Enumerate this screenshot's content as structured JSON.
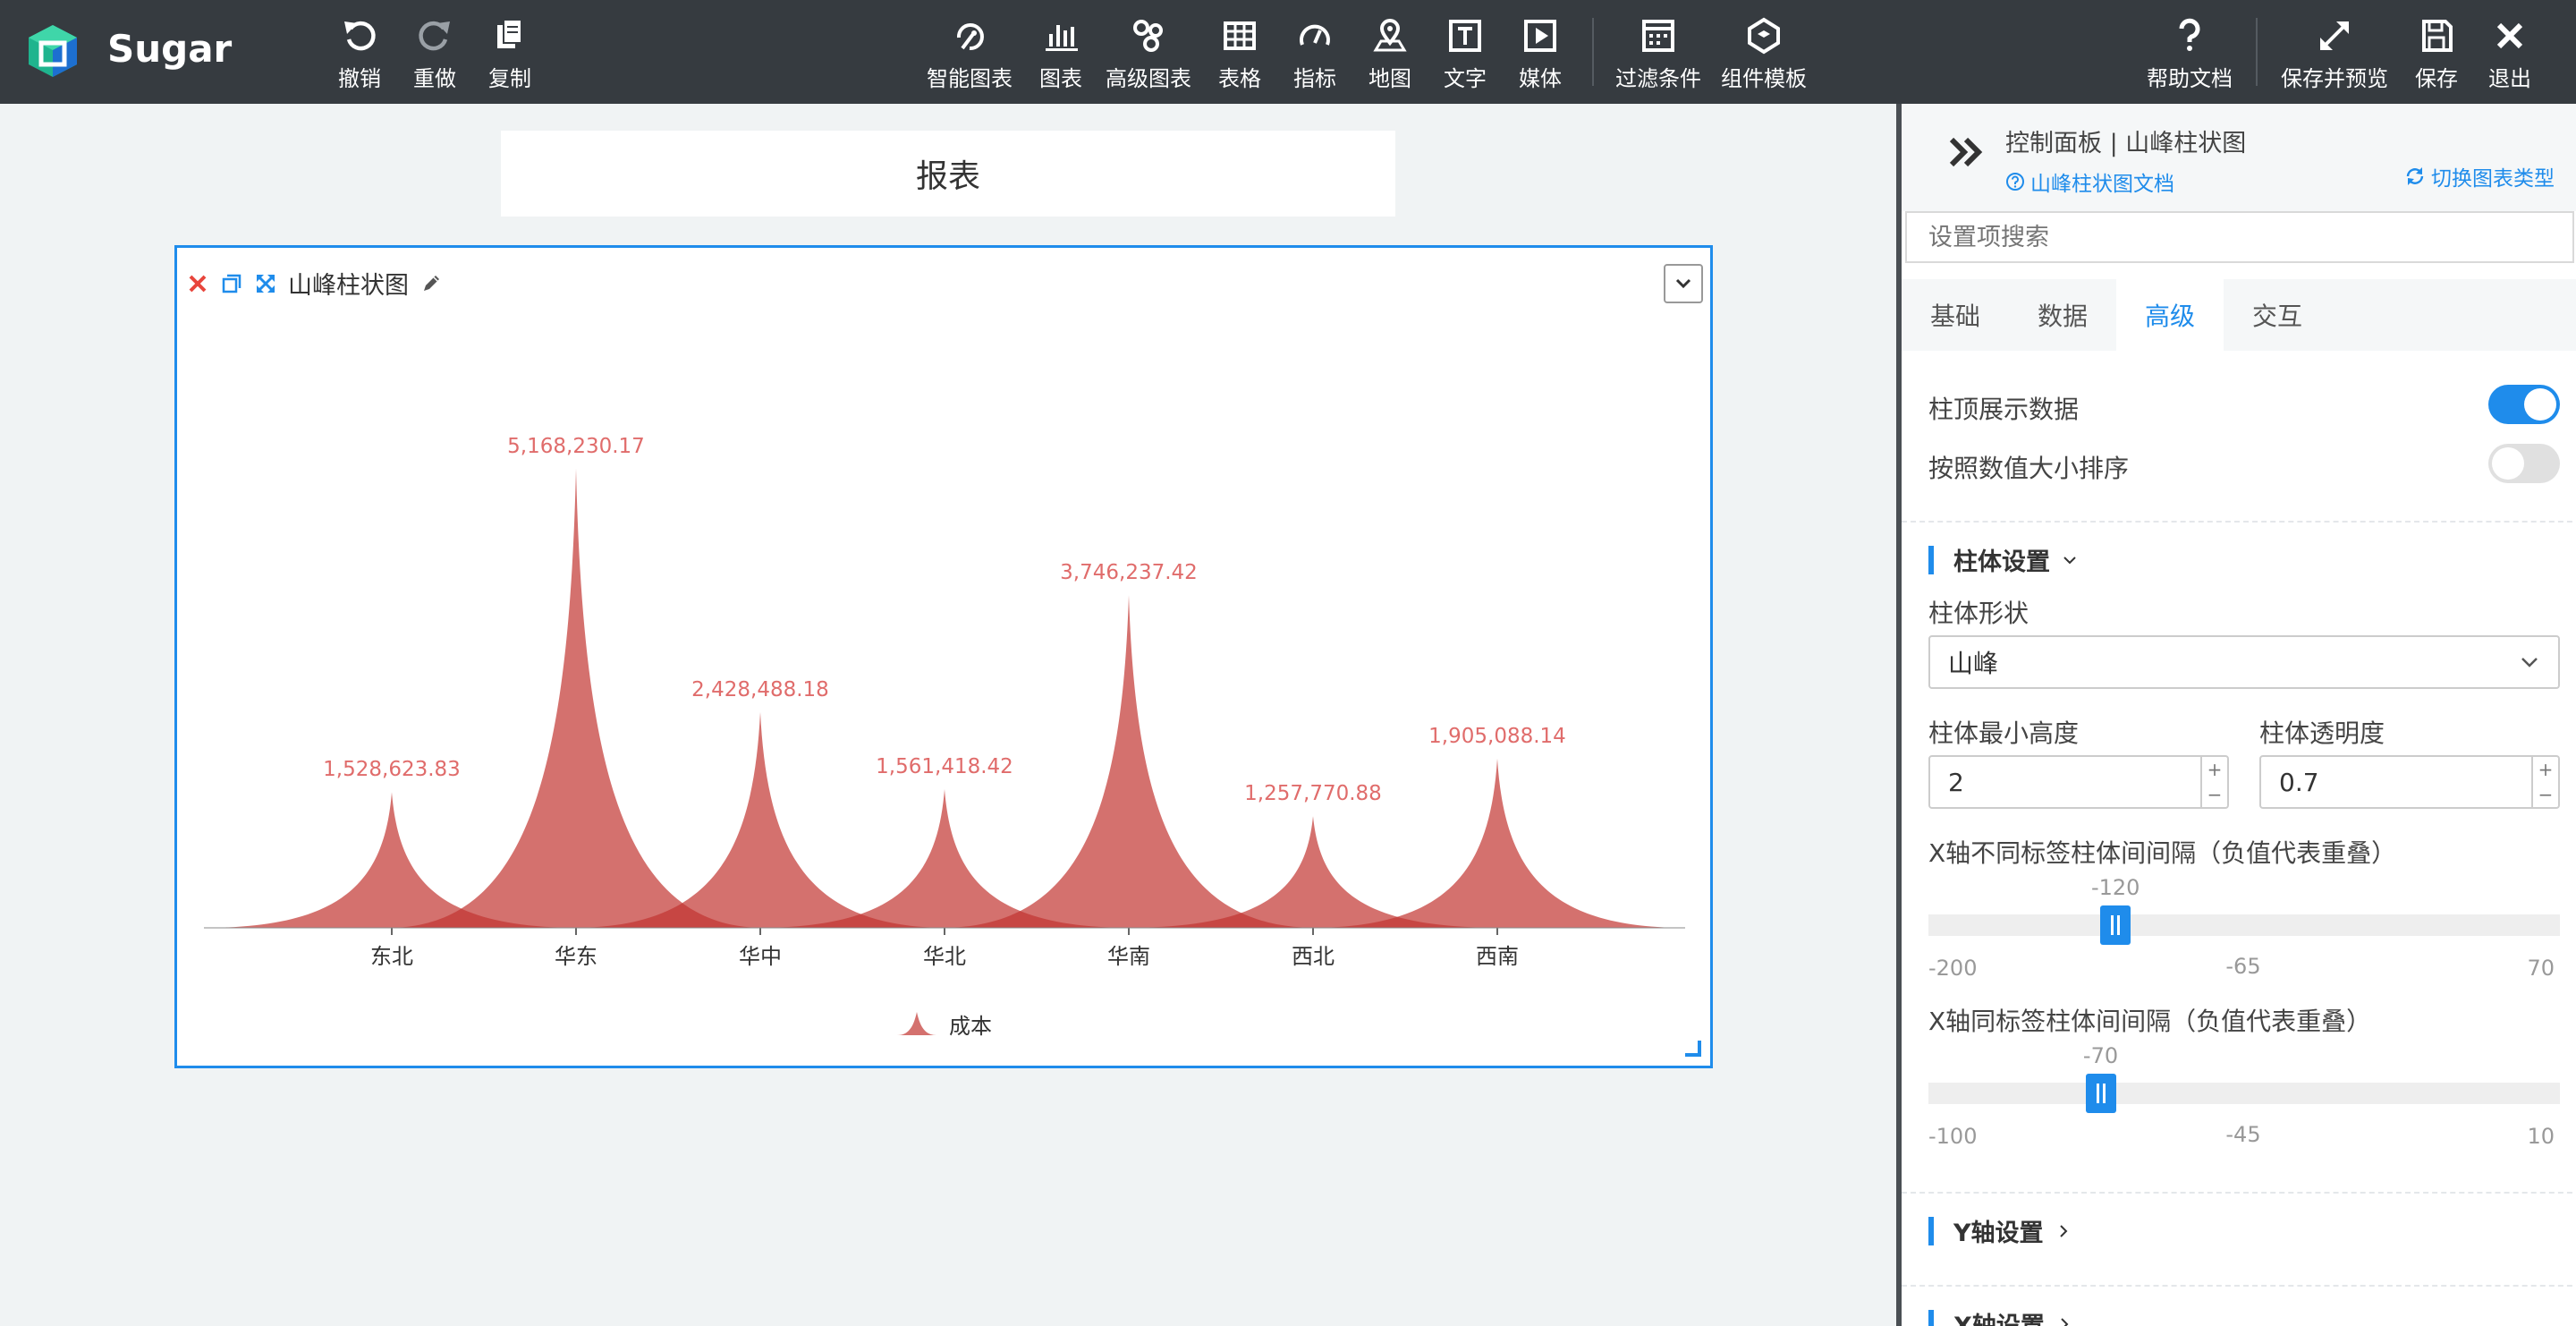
{
  "app": {
    "brand": "Sugar",
    "accent": "#1f8ceb",
    "toolbar_bg": "#363b40"
  },
  "toolbar_left": [
    {
      "label": "撤销",
      "icon": "undo-icon"
    },
    {
      "label": "重做",
      "icon": "redo-icon"
    },
    {
      "label": "复制",
      "icon": "copy-icon"
    }
  ],
  "toolbar_center": [
    {
      "label": "智能图表",
      "icon": "smart-chart-icon"
    },
    {
      "label": "图表",
      "icon": "bar-chart-icon"
    },
    {
      "label": "高级图表",
      "icon": "advanced-chart-icon"
    },
    {
      "label": "表格",
      "icon": "table-icon"
    },
    {
      "label": "指标",
      "icon": "gauge-icon"
    },
    {
      "label": "地图",
      "icon": "map-pin-icon"
    },
    {
      "label": "文字",
      "icon": "text-icon"
    },
    {
      "label": "媒体",
      "icon": "media-icon"
    }
  ],
  "toolbar_mid": [
    {
      "label": "过滤条件",
      "icon": "filter-icon"
    },
    {
      "label": "组件模板",
      "icon": "template-icon"
    }
  ],
  "toolbar_right": [
    {
      "label": "帮助文档",
      "icon": "help-icon"
    },
    {
      "label": "保存并预览",
      "icon": "expand-icon"
    },
    {
      "label": "保存",
      "icon": "save-icon"
    },
    {
      "label": "退出",
      "icon": "close-icon"
    }
  ],
  "report": {
    "title": "报表"
  },
  "widget": {
    "title": "山峰柱状图"
  },
  "chart_data": {
    "type": "bar",
    "bar_shape": "peak",
    "categories": [
      "东北",
      "华东",
      "华中",
      "华北",
      "华南",
      "西北",
      "西南"
    ],
    "series": [
      {
        "name": "成本",
        "color": "#c23531",
        "opacity": 0.7,
        "values": [
          1528623.83,
          5168230.17,
          2428488.18,
          1561418.42,
          3746237.42,
          1257770.88,
          1905088.14
        ],
        "labels": [
          "1,528,623.83",
          "5,168,230.17",
          "2,428,488.18",
          "1,561,418.42",
          "3,746,237.42",
          "1,257,770.88",
          "1,905,088.14"
        ]
      }
    ],
    "ylim": [
      0,
      5500000
    ],
    "grid": false,
    "legend_position": "bottom-center",
    "label_color": "#e06c6b"
  },
  "panel": {
    "title": "控制面板 | 山峰柱状图",
    "doc_link": "山峰柱状图文档",
    "switch_type": "切换图表类型",
    "search_placeholder": "设置项搜索",
    "tabs": [
      "基础",
      "数据",
      "高级",
      "交互"
    ],
    "active_tab": "高级",
    "show_top_data": {
      "label": "柱顶展示数据",
      "on": true
    },
    "sort_by_value": {
      "label": "按照数值大小排序",
      "on": false
    },
    "bar_section": "柱体设置",
    "bar_shape_label": "柱体形状",
    "bar_shape_value": "山峰",
    "min_height_label": "柱体最小高度",
    "min_height_value": "2",
    "opacity_label": "柱体透明度",
    "opacity_value": "0.7",
    "stepper_plus": "+",
    "stepper_minus": "−",
    "gap_diff_label": "X轴不同标签柱体间间隔（负值代表重叠）",
    "gap_diff": {
      "value": -120,
      "value_text": "-120",
      "min": -200,
      "max": 70,
      "min_text": "-200",
      "mid_text": "-65",
      "max_text": "70"
    },
    "gap_same_label": "X轴同标签柱体间间隔（负值代表重叠）",
    "gap_same": {
      "value": -70,
      "value_text": "-70",
      "min": -100,
      "max": 10,
      "min_text": "-100",
      "mid_text": "-45",
      "max_text": "10"
    },
    "y_axis_section": "Y轴设置",
    "x_axis_section": "X轴设置"
  }
}
